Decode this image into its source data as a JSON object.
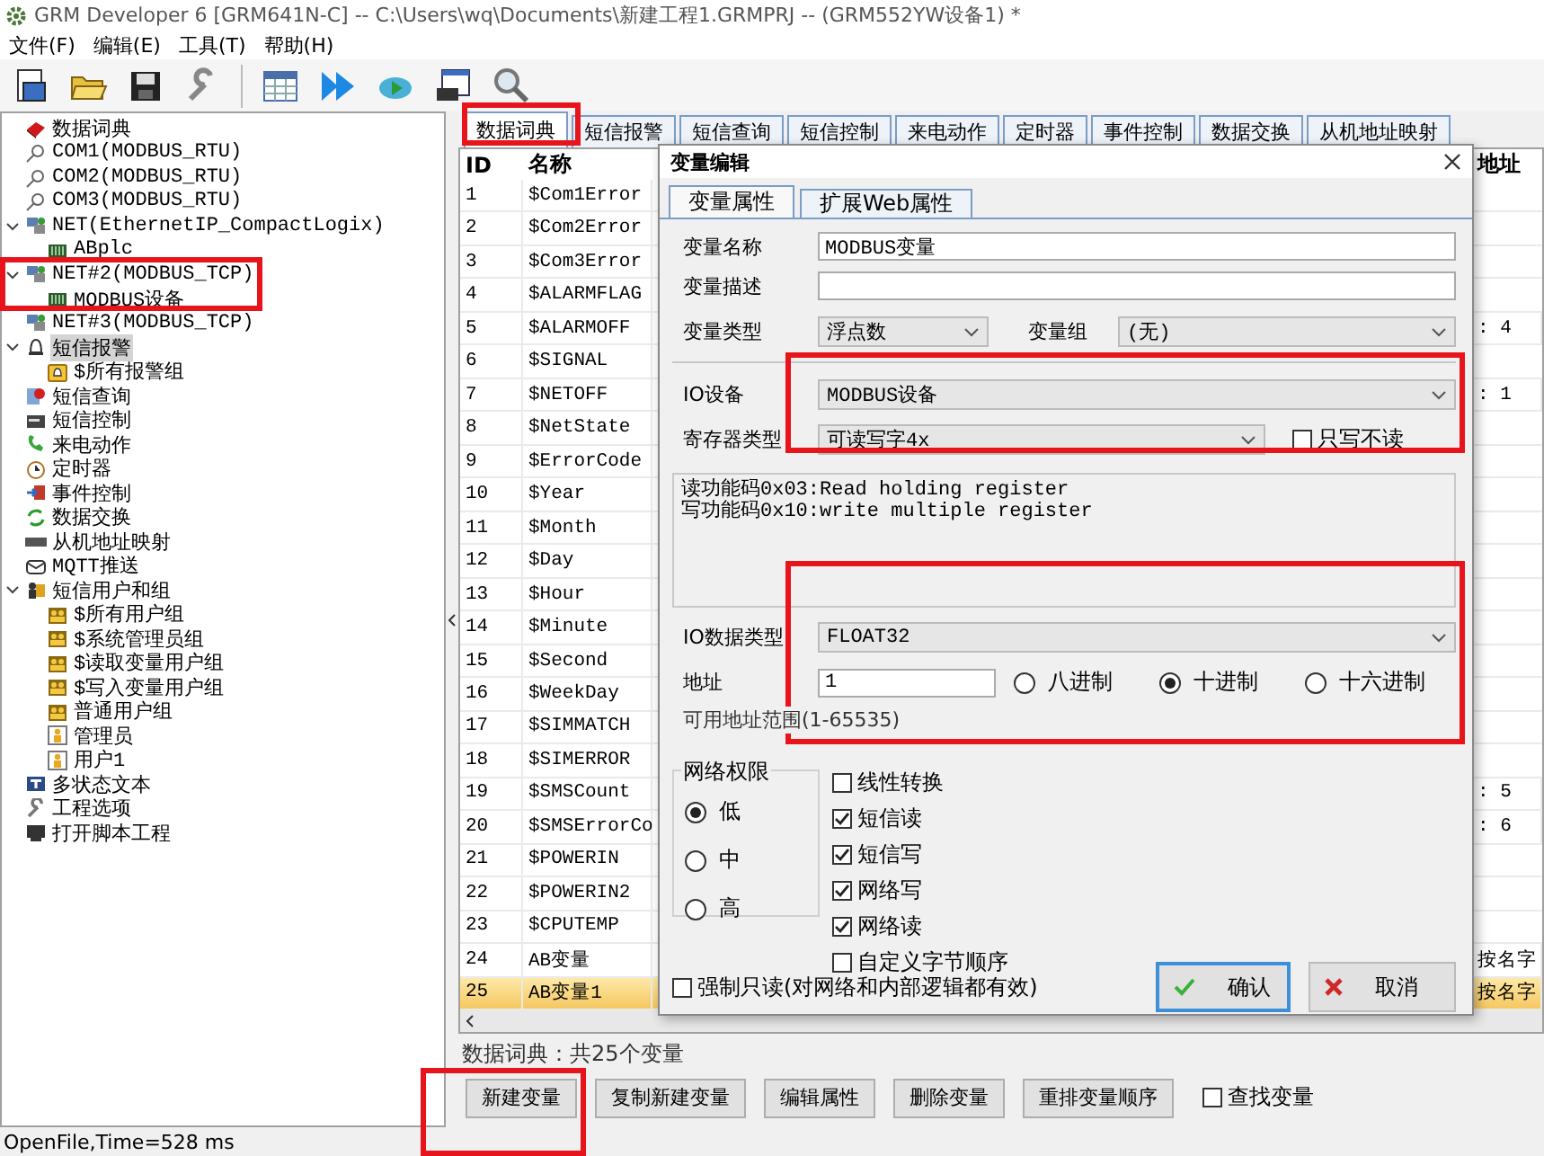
{
  "window": {
    "title": "GRM Developer 6 [GRM641N-C]  -- C:\\Users\\wq\\Documents\\新建工程1.GRMPRJ -- (GRM552YW设备1) *"
  },
  "menu": [
    "文件(F)",
    "编辑(E)",
    "工具(T)",
    "帮助(H)"
  ],
  "tree": [
    {
      "label": "数据词典",
      "kind": "dictionary",
      "selected": false
    },
    {
      "label": "COM1(MODBUS_RTU)",
      "kind": "port",
      "selected": false
    },
    {
      "label": "COM2(MODBUS_RTU)",
      "kind": "port",
      "selected": false
    },
    {
      "label": "COM3(MODBUS_RTU)",
      "kind": "port",
      "selected": false
    },
    {
      "label": "NET(EthernetIP_CompactLogix)",
      "kind": "network",
      "selected": false,
      "expanded": true,
      "children": [
        {
          "label": "ABplc",
          "kind": "device",
          "selected": false
        }
      ]
    },
    {
      "label": "NET#2(MODBUS_TCP)",
      "kind": "network",
      "selected": false,
      "expanded": true,
      "children": [
        {
          "label": "MODBUS设备",
          "kind": "device",
          "selected": false
        }
      ]
    },
    {
      "label": "NET#3(MODBUS_TCP)",
      "kind": "network",
      "selected": false
    },
    {
      "label": "短信报警",
      "kind": "alarm",
      "selected": true,
      "expanded": true,
      "children": [
        {
          "label": "$所有报警组",
          "kind": "alarm-group",
          "selected": false
        }
      ]
    },
    {
      "label": "短信查询",
      "kind": "query",
      "selected": false
    },
    {
      "label": "短信控制",
      "kind": "control",
      "selected": false
    },
    {
      "label": "来电动作",
      "kind": "call",
      "selected": false
    },
    {
      "label": "定时器",
      "kind": "timer",
      "selected": false
    },
    {
      "label": "事件控制",
      "kind": "event",
      "selected": false
    },
    {
      "label": "数据交换",
      "kind": "exchange",
      "selected": false
    },
    {
      "label": "从机地址映射",
      "kind": "mapping",
      "selected": false
    },
    {
      "label": "MQTT推送",
      "kind": "mqtt",
      "selected": false
    },
    {
      "label": "短信用户和组",
      "kind": "users",
      "selected": false,
      "expanded": true,
      "children": [
        {
          "label": "$所有用户组",
          "kind": "user-group",
          "selected": false
        },
        {
          "label": "$系统管理员组",
          "kind": "user-group",
          "selected": false
        },
        {
          "label": "$读取变量用户组",
          "kind": "user-group",
          "selected": false
        },
        {
          "label": "$写入变量用户组",
          "kind": "user-group",
          "selected": false
        },
        {
          "label": "普通用户组",
          "kind": "user-group",
          "selected": false
        },
        {
          "label": "管理员",
          "kind": "user",
          "selected": false
        },
        {
          "label": "用户1",
          "kind": "user",
          "selected": false
        }
      ]
    },
    {
      "label": "多状态文本",
      "kind": "text",
      "selected": false
    },
    {
      "label": "工程选项",
      "kind": "options",
      "selected": false
    },
    {
      "label": "打开脚本工程",
      "kind": "script",
      "selected": false
    }
  ],
  "tabs": [
    {
      "label": "数据词典",
      "selected": true
    },
    {
      "label": "短信报警",
      "selected": false
    },
    {
      "label": "短信查询",
      "selected": false
    },
    {
      "label": "短信控制",
      "selected": false
    },
    {
      "label": "来电动作",
      "selected": false
    },
    {
      "label": "定时器",
      "selected": false
    },
    {
      "label": "事件控制",
      "selected": false
    },
    {
      "label": "数据交换",
      "selected": false
    },
    {
      "label": "从机地址映射",
      "selected": false
    }
  ],
  "table": {
    "columns": [
      "ID",
      "名称",
      "地址"
    ],
    "rows": [
      {
        "id": "1",
        "name": "$Com1Error",
        "selected": false
      },
      {
        "id": "2",
        "name": "$Com2Error",
        "selected": false
      },
      {
        "id": "3",
        "name": "$Com3Error",
        "selected": false
      },
      {
        "id": "4",
        "name": "$ALARMFLAG",
        "selected": false
      },
      {
        "id": "5",
        "name": "$ALARMOFF",
        "address": ": 4",
        "selected": false
      },
      {
        "id": "6",
        "name": "$SIGNAL",
        "selected": false
      },
      {
        "id": "7",
        "name": "$NETOFF",
        "address": ": 1",
        "selected": false
      },
      {
        "id": "8",
        "name": "$NetState",
        "selected": false
      },
      {
        "id": "9",
        "name": "$ErrorCode",
        "selected": false
      },
      {
        "id": "10",
        "name": "$Year",
        "selected": false
      },
      {
        "id": "11",
        "name": "$Month",
        "selected": false
      },
      {
        "id": "12",
        "name": "$Day",
        "selected": false
      },
      {
        "id": "13",
        "name": "$Hour",
        "selected": false
      },
      {
        "id": "14",
        "name": "$Minute",
        "selected": false
      },
      {
        "id": "15",
        "name": "$Second",
        "selected": false
      },
      {
        "id": "16",
        "name": "$WeekDay",
        "selected": false
      },
      {
        "id": "17",
        "name": "$SIMMATCH",
        "selected": false
      },
      {
        "id": "18",
        "name": "$SIMERROR",
        "selected": false
      },
      {
        "id": "19",
        "name": "$SMSCount",
        "address": ": 5",
        "selected": false
      },
      {
        "id": "20",
        "name": "$SMSErrorCo",
        "address": ": 6",
        "selected": false
      },
      {
        "id": "21",
        "name": "$POWERIN",
        "selected": false
      },
      {
        "id": "22",
        "name": "$POWERIN2",
        "selected": false
      },
      {
        "id": "23",
        "name": "$CPUTEMP",
        "selected": false
      },
      {
        "id": "24",
        "name": "AB变量",
        "address": "按名字",
        "selected": false
      },
      {
        "id": "25",
        "name": "AB变量1",
        "address": "按名字",
        "selected": true
      }
    ]
  },
  "summary": "数据词典：共25个变量",
  "buttons": [
    "新建变量",
    "复制新建变量",
    "编辑属性",
    "删除变量",
    "重排变量顺序"
  ],
  "find_checkbox": {
    "label": "查找变量",
    "checked": false
  },
  "status_bar": "OpenFile,Time=528 ms",
  "dialog": {
    "title": "变量编辑",
    "tabs": [
      {
        "label": "变量属性",
        "selected": true
      },
      {
        "label": "扩展Web属性",
        "selected": false
      }
    ],
    "name": {
      "label": "变量名称",
      "value": "MODBUS变量"
    },
    "description": {
      "label": "变量描述"
    },
    "type": {
      "label": "变量类型",
      "value": "浮点数"
    },
    "group": {
      "label": "变量组",
      "value": "(无)"
    },
    "io_device": {
      "label": "IO设备",
      "value": "MODBUS设备"
    },
    "register_type": {
      "label": "寄存器类型",
      "value": "可读写字4x"
    },
    "write_only": {
      "label": "只写不读",
      "checked": false
    },
    "function_info": [
      "读功能码0x03:Read holding register",
      "写功能码0x10:write multiple register"
    ],
    "io_data_type": {
      "label": "IO数据类型",
      "value": "FLOAT32"
    },
    "address": {
      "label": "地址",
      "value": "1"
    },
    "radix": [
      {
        "label": "八进制",
        "selected": false
      },
      {
        "label": "十进制",
        "selected": true
      },
      {
        "label": "十六进制",
        "selected": false
      }
    ],
    "address_range": "可用地址范围(1-65535)",
    "permission": {
      "title": "网络权限",
      "options": [
        {
          "label": "低",
          "selected": true
        },
        {
          "label": "中",
          "selected": false
        },
        {
          "label": "高",
          "selected": false
        }
      ]
    },
    "options": [
      {
        "label": "线性转换",
        "checked": false
      },
      {
        "label": "短信读",
        "checked": true
      },
      {
        "label": "短信写",
        "checked": true
      },
      {
        "label": "网络写",
        "checked": true
      },
      {
        "label": "网络读",
        "checked": true
      },
      {
        "label": "自定义字节顺序",
        "checked": false
      }
    ],
    "force_readonly": {
      "label": "强制只读(对网络和内部逻辑都有效)",
      "checked": false
    },
    "buttons": [
      {
        "label": "确认",
        "kind": "ok",
        "focused": true
      },
      {
        "label": "取消",
        "kind": "cancel",
        "focused": false
      }
    ]
  }
}
